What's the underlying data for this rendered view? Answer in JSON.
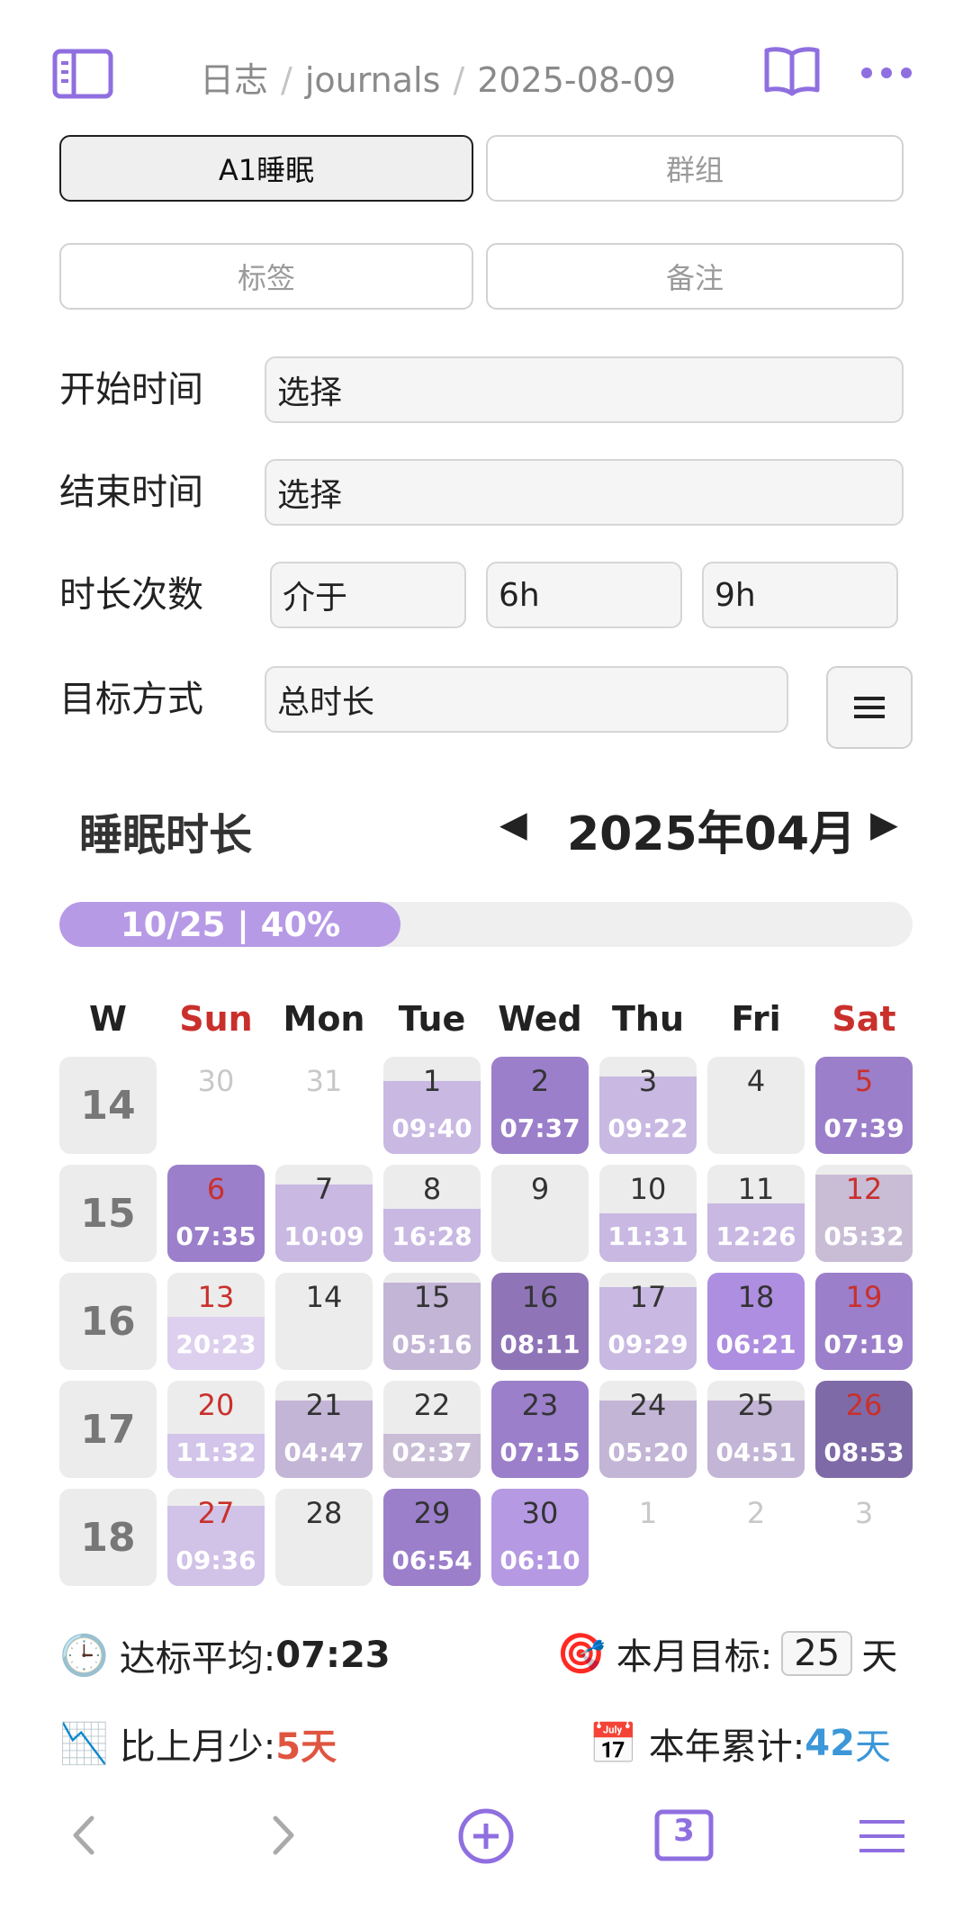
{
  "header": {
    "breadcrumb": [
      "日志",
      "journals",
      "2025-08-09"
    ],
    "accent": "#8f6fe0"
  },
  "filters": {
    "tabs": [
      {
        "label": "A1睡眠",
        "active": true
      },
      {
        "label": "群组",
        "active": false
      },
      {
        "label": "标签",
        "active": false
      },
      {
        "label": "备注",
        "active": false
      }
    ]
  },
  "form": {
    "start_label": "开始时间",
    "start_value": "选择",
    "end_label": "结束时间",
    "end_value": "选择",
    "duration_label": "时长次数",
    "duration_mode": "介于",
    "duration_min": "6h",
    "duration_max": "9h",
    "goal_label": "目标方式",
    "goal_value": "总时长"
  },
  "calendar": {
    "title": "睡眠时长",
    "prev": "◀",
    "month": "2025年04月",
    "next": "▶",
    "progress_label": "10/25 | 40%",
    "progress_fraction": 0.4,
    "headers": [
      "W",
      "Sun",
      "Mon",
      "Tue",
      "Wed",
      "Thu",
      "Fri",
      "Sat"
    ],
    "weeks": [
      {
        "week": "14",
        "days": [
          {
            "n": "30",
            "muted": true
          },
          {
            "n": "31",
            "muted": true
          },
          {
            "n": "1",
            "dur": "09:40",
            "fill": 0.75,
            "color": "#c8b8e2"
          },
          {
            "n": "2",
            "dur": "07:37",
            "fill": 1.0,
            "color": "#9b7fca"
          },
          {
            "n": "3",
            "dur": "09:22",
            "fill": 0.8,
            "color": "#c8b8e2"
          },
          {
            "n": "4",
            "empty": true
          },
          {
            "n": "5",
            "dur": "07:39",
            "fill": 1.0,
            "color": "#9b7fca",
            "red": true
          }
        ]
      },
      {
        "week": "15",
        "days": [
          {
            "n": "6",
            "dur": "07:35",
            "fill": 1.0,
            "color": "#9b7fca",
            "red": true
          },
          {
            "n": "7",
            "dur": "10:09",
            "fill": 0.8,
            "color": "#c8b8e2"
          },
          {
            "n": "8",
            "dur": "16:28",
            "fill": 0.55,
            "color": "#c8b8e2"
          },
          {
            "n": "9",
            "empty": true
          },
          {
            "n": "10",
            "dur": "11:31",
            "fill": 0.5,
            "color": "#c8b8e2"
          },
          {
            "n": "11",
            "dur": "12:26",
            "fill": 0.6,
            "color": "#c8b8e2"
          },
          {
            "n": "12",
            "dur": "05:32",
            "fill": 0.9,
            "color": "#c9bdd6",
            "red": true
          }
        ]
      },
      {
        "week": "16",
        "days": [
          {
            "n": "13",
            "dur": "20:23",
            "fill": 0.55,
            "color": "#ddd0ee",
            "red": true
          },
          {
            "n": "14",
            "empty": true
          },
          {
            "n": "15",
            "dur": "05:16",
            "fill": 0.9,
            "color": "#c3b5d6"
          },
          {
            "n": "16",
            "dur": "08:11",
            "fill": 1.0,
            "color": "#8f75b8"
          },
          {
            "n": "17",
            "dur": "09:29",
            "fill": 0.85,
            "color": "#c8b8e2"
          },
          {
            "n": "18",
            "dur": "06:21",
            "fill": 1.0,
            "color": "#ae8ee0"
          },
          {
            "n": "19",
            "dur": "07:19",
            "fill": 1.0,
            "color": "#9b7fca",
            "red": true
          }
        ]
      },
      {
        "week": "17",
        "days": [
          {
            "n": "20",
            "dur": "11:32",
            "fill": 0.45,
            "color": "#d3c4ea",
            "red": true
          },
          {
            "n": "21",
            "dur": "04:47",
            "fill": 0.8,
            "color": "#c3b5d6"
          },
          {
            "n": "22",
            "dur": "02:37",
            "fill": 0.45,
            "color": "#c9bdd6"
          },
          {
            "n": "23",
            "dur": "07:15",
            "fill": 1.0,
            "color": "#9b7fca"
          },
          {
            "n": "24",
            "dur": "05:20",
            "fill": 0.8,
            "color": "#c3b5d6"
          },
          {
            "n": "25",
            "dur": "04:51",
            "fill": 0.8,
            "color": "#c3b5d6"
          },
          {
            "n": "26",
            "dur": "08:53",
            "fill": 1.0,
            "color": "#7f6aa8",
            "red": true
          }
        ]
      },
      {
        "week": "18",
        "days": [
          {
            "n": "27",
            "dur": "09:36",
            "fill": 0.82,
            "color": "#d1c2e7",
            "red": true
          },
          {
            "n": "28",
            "empty": true
          },
          {
            "n": "29",
            "dur": "06:54",
            "fill": 1.0,
            "color": "#9b7fca"
          },
          {
            "n": "30",
            "dur": "06:10",
            "fill": 1.0,
            "color": "#b599e3"
          },
          {
            "n": "1",
            "muted": true
          },
          {
            "n": "2",
            "muted": true
          },
          {
            "n": "3",
            "muted": true
          }
        ]
      }
    ]
  },
  "stats": {
    "avg_icon": "clock-icon",
    "avg_label": "达标平均: ",
    "avg_value": "07:23",
    "goal_icon": "dart-icon",
    "goal_label": "本月目标: ",
    "goal_value": "25",
    "goal_unit": "天",
    "less_icon": "chart-down-icon",
    "less_label": "比上月少: ",
    "less_value": "5天",
    "less_color": "#e05540",
    "year_icon": "calendar-icon",
    "year_label": "本年累计: ",
    "year_value": "42",
    "year_unit": "天",
    "year_color": "#3b97d8"
  },
  "bottom_nav": {
    "tab_count": "3"
  }
}
